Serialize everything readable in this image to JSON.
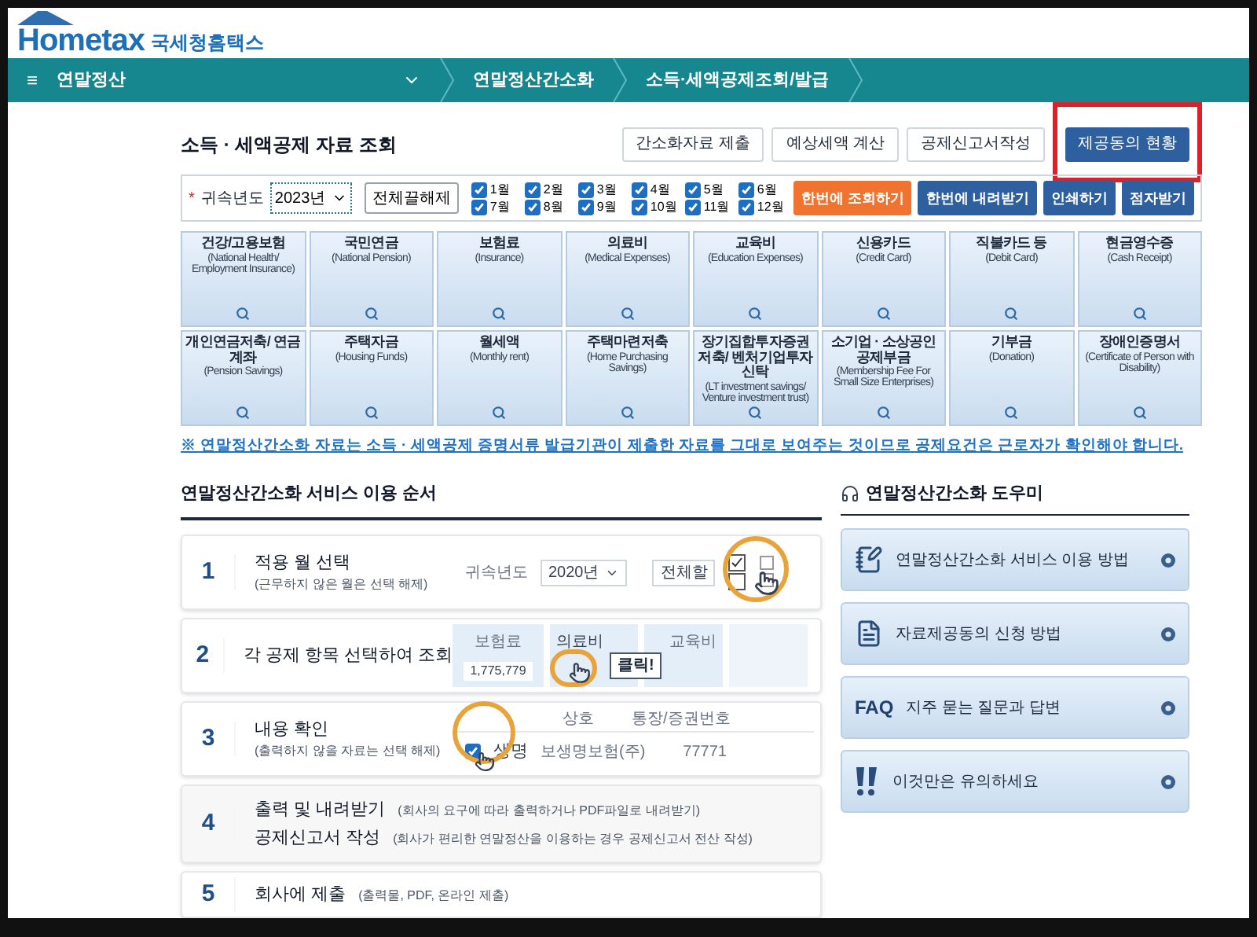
{
  "header": {
    "logo": "Hometax",
    "logo_suffix": "국세청홈택스"
  },
  "nav": {
    "menu_icon": "≡",
    "menu": "연말정산",
    "breadcrumbs": [
      "연말정산간소화",
      "소득·세액공제조회/발급"
    ]
  },
  "page_title": "소득 · 세액공제 자료 조회",
  "top_buttons": [
    {
      "label": "간소화자료 제출",
      "highlighted": false
    },
    {
      "label": "예상세액 계산",
      "highlighted": false
    },
    {
      "label": "공제신고서작성",
      "highlighted": false
    },
    {
      "label": "제공동의 현황",
      "highlighted": true
    }
  ],
  "filter": {
    "required_mark": "*",
    "year_label": "귀속년도",
    "year": "2023년",
    "toggle_all": "전체끌해제",
    "months": [
      {
        "label": "1월",
        "checked": true
      },
      {
        "label": "7월",
        "checked": true
      },
      {
        "label": "2월",
        "checked": true
      },
      {
        "label": "8월",
        "checked": true
      },
      {
        "label": "3월",
        "checked": true
      },
      {
        "label": "9월",
        "checked": true
      },
      {
        "label": "4월",
        "checked": true
      },
      {
        "label": "10월",
        "checked": true
      },
      {
        "label": "5월",
        "checked": true
      },
      {
        "label": "11월",
        "checked": true
      },
      {
        "label": "6월",
        "checked": true
      },
      {
        "label": "12월",
        "checked": true
      }
    ],
    "actions": [
      {
        "label": "한번에 조회하기",
        "kind": "primary"
      },
      {
        "label": "한번에 내려받기",
        "kind": "secondary"
      },
      {
        "label": "인쇄하기",
        "kind": "secondary"
      },
      {
        "label": "점자받기",
        "kind": "secondary"
      }
    ]
  },
  "categories": [
    {
      "name": "건강/고용보험",
      "english": "(National Health/ Employment Insurance)"
    },
    {
      "name": "국민연금",
      "english": "(National Pension)"
    },
    {
      "name": "보험료",
      "english": "(Insurance)"
    },
    {
      "name": "의료비",
      "english": "(Medical Expenses)"
    },
    {
      "name": "교육비",
      "english": "(Education Expenses)"
    },
    {
      "name": "신용카드",
      "english": "(Credit Card)"
    },
    {
      "name": "직불카드 등",
      "english": "(Debit Card)"
    },
    {
      "name": "현금영수증",
      "english": "(Cash Receipt)"
    },
    {
      "name": "개인연금저축/ 연금계좌",
      "english": "(Pension Savings)"
    },
    {
      "name": "주택자금",
      "english": "(Housing Funds)"
    },
    {
      "name": "월세액",
      "english": "(Monthly rent)"
    },
    {
      "name": "주택마련저축",
      "english": "(Home Purchasing Savings)"
    },
    {
      "name": "장기집합투자증권저축/ 벤처기업투자신탁",
      "english": "(LT investment savings/ Venture investment trust)"
    },
    {
      "name": "소기업 · 소상공인 공제부금",
      "english": "(Membership Fee For Small Size Enterprises)"
    },
    {
      "name": "기부금",
      "english": "(Donation)"
    },
    {
      "name": "장애인증명서",
      "english": "(Certificate of Person with Disability)"
    }
  ],
  "notice": "※ 연말정산간소화 자료는 소득 · 세액공제 증명서류 발급기관이 제출한 자료를 그대로 보여주는 것이므로 공제요건은 근로자가 확인해야 합니다.",
  "guide": {
    "title": "연말정산간소화 서비스 이용 순서",
    "steps": [
      {
        "number": "1",
        "kind": "stacked",
        "lines": [
          {
            "title": "적용 월 선택",
            "note": "(근무하지 않은 월은 선택 해제)"
          }
        ],
        "illustration": {
          "kind": "months",
          "labels": [
            "귀속년도",
            "2020년",
            "전체할"
          ]
        }
      },
      {
        "number": "2",
        "kind": "stacked",
        "lines": [
          {
            "title": "각 공제 항목 선택하여 조회"
          }
        ],
        "illustration": {
          "kind": "categories",
          "labels": [
            "보험료",
            "1,775,779",
            "의료비",
            "클릭!",
            "교육비"
          ]
        }
      },
      {
        "number": "3",
        "kind": "stacked",
        "lines": [
          {
            "title": "내용 확인",
            "note": "(출력하지 않을 자료는 선택 해제)"
          }
        ],
        "illustration": {
          "kind": "confirm",
          "checked": true,
          "labels": [
            "상호",
            "통장/증권번호",
            "생명",
            "보생명보험(주)",
            "77771"
          ]
        }
      },
      {
        "number": "4",
        "kind": "inline",
        "lines": [
          {
            "title": "출력 및 내려받기",
            "note": "(회사의 요구에 따라 출력하거나 PDF파일로 내려받기)"
          },
          {
            "title": "공제신고서 작성",
            "note": "(회사가 편리한 연말정산을 이용하는 경우 공제신고서 전산 작성)"
          }
        ]
      },
      {
        "number": "5",
        "kind": "inline",
        "lines": [
          {
            "title": "회사에 제출",
            "note": "(출력물, PDF, 온라인 제출)"
          }
        ]
      }
    ]
  },
  "helper": {
    "title": "연말정산간소화 도우미",
    "items": [
      {
        "label": "연말정산간소화 서비스 이용 방법",
        "kind": "manual"
      },
      {
        "label": "자료제공동의 신청 방법",
        "kind": "form"
      },
      {
        "label": "지주 묻는 질문과 답변",
        "kind": "faq",
        "badge": "FAQ"
      },
      {
        "label": "이것만은 유의하세요",
        "kind": "alert"
      }
    ]
  }
}
